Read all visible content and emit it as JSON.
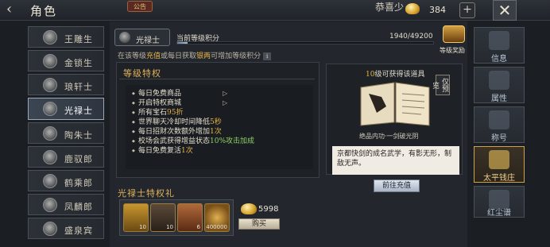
{
  "header": {
    "back_icon": "chevron-left-icon",
    "title": "角色",
    "notice_badge": "公告",
    "player_name": "恭喜少",
    "silver_value": "384",
    "plus_label": "+",
    "close_label": "✕"
  },
  "ranks": [
    {
      "label": "王雕生"
    },
    {
      "label": "金锁生"
    },
    {
      "label": "琅轩士"
    },
    {
      "label": "光禄士"
    },
    {
      "label": "陶朱士"
    },
    {
      "label": "鹿驭郎"
    },
    {
      "label": "鹤乘郎"
    },
    {
      "label": "凤麟郎"
    },
    {
      "label": "盛泉宾"
    }
  ],
  "current": {
    "rank_label": "光禄士",
    "points_label": "当前等级积分",
    "points_value": "1940/49200",
    "progress": 0.039,
    "chest_label": "等级奖励"
  },
  "hint": {
    "pre": "在该等级",
    "v1": "充值",
    "mid": "或每日获取",
    "v2": "银两",
    "post": "可增加等级积分"
  },
  "privileges": {
    "title": "等级特权",
    "items": [
      {
        "a": "每日免费商品",
        "b": "",
        "c": ""
      },
      {
        "a": "开启特权商城",
        "b": "",
        "c": ""
      },
      {
        "a": "所有宝石",
        "b": "95折",
        "c": ""
      },
      {
        "a": "世界聊天冷却时间降低",
        "b": "5秒",
        "c": ""
      },
      {
        "a": "每日招财次数额外增加",
        "b": "1次",
        "c": ""
      },
      {
        "a": "校场会武获得增益状态",
        "b": "",
        "c": "10%攻击加成"
      },
      {
        "a": "每日免费复活",
        "b": "1次",
        "c": ""
      }
    ]
  },
  "special": {
    "title": "光禄士特权礼",
    "items": [
      {
        "qty": "10"
      },
      {
        "qty": "10"
      },
      {
        "qty": "6"
      },
      {
        "qty": "400000"
      }
    ],
    "price": "5998",
    "buy_label": "购买"
  },
  "reward": {
    "level": "10",
    "title_rest": "级可获得该道具",
    "preview_label": "仅预览",
    "book_caption": "绝品内功·一剑破光阴",
    "desc": "京都快剑的成名武学，有影无形，制敌无声。",
    "pay_label": "前往充值"
  },
  "tabs": [
    {
      "label": "信息"
    },
    {
      "label": "属性"
    },
    {
      "label": "称号"
    },
    {
      "label": "太平钱庄"
    },
    {
      "label": "红尘谱"
    }
  ]
}
